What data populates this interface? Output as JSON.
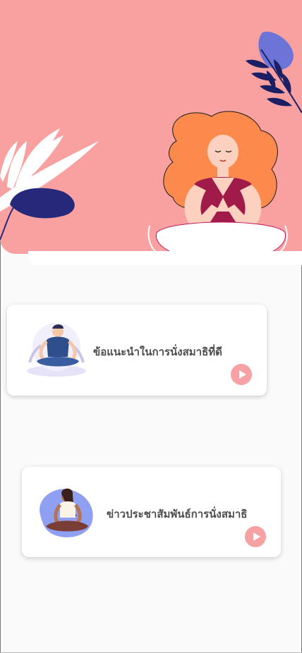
{
  "hero": {
    "illustration": "woman-meditating-lotus",
    "background_color": "#f9a1a1"
  },
  "cards": [
    {
      "title": "ข้อแนะนำในการนั่งสมาธิที่ดี",
      "illustration": "man-meditating",
      "action_icon": "play-icon"
    },
    {
      "title": "ข่าวประชาสัมพันธ์การนั่งสมาธิ",
      "illustration": "woman-meditating",
      "action_icon": "play-icon"
    }
  ],
  "colors": {
    "accent": "#f6a1a4",
    "text": "#4d4d4d",
    "navy": "#1f2a6b"
  }
}
